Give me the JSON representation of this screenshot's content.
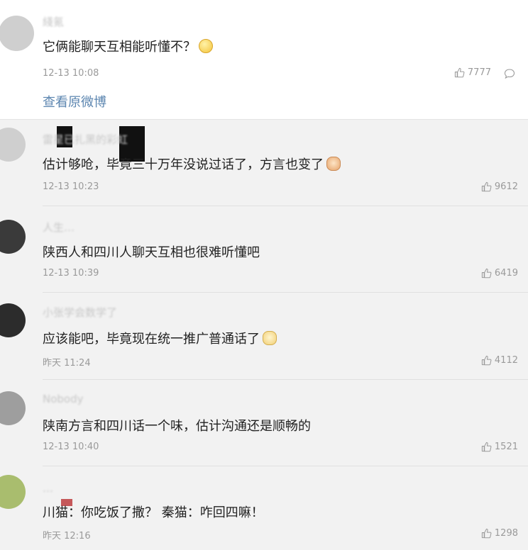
{
  "comment_thread": {
    "top": {
      "username": "綫氪",
      "text": "它俩能聊天互相能听懂不？",
      "emoji": "thinking-face-emoji",
      "time": "12-13 10:08",
      "likes": "7777",
      "view_original": "查看原微博"
    },
    "comments": [
      {
        "username": "雷星已扎黑的彩虹",
        "text": "估计够呛，毕竟三十万年没说过话了，方言也变了",
        "emoji": "cat-face-emoji",
        "time": "12-13 10:23",
        "likes": "9612"
      },
      {
        "username": "人生…",
        "text": "陕西人和四川人聊天互相也很难听懂吧",
        "emoji": "",
        "time": "12-13 10:39",
        "likes": "6419"
      },
      {
        "username": "小张学会数学了",
        "text": "应该能吧，毕竟现在统一推广普通话了",
        "emoji": "cat-face-emoji",
        "time": "昨天 11:24",
        "likes": "4112"
      },
      {
        "username": "Nobody",
        "text": "陕南方言和四川话一个味，估计沟通还是顺畅的",
        "emoji": "",
        "time": "12-13 10:40",
        "likes": "1521"
      },
      {
        "username": "…",
        "text": "川猫：你吃饭了撒？ 秦猫：咋回四嘛！",
        "emoji": "",
        "time": "昨天 12:16",
        "likes": "1298"
      }
    ]
  },
  "colors": {
    "link": "#5c86b0",
    "meta": "#9a9a9a",
    "background": "#f2f2f2"
  }
}
